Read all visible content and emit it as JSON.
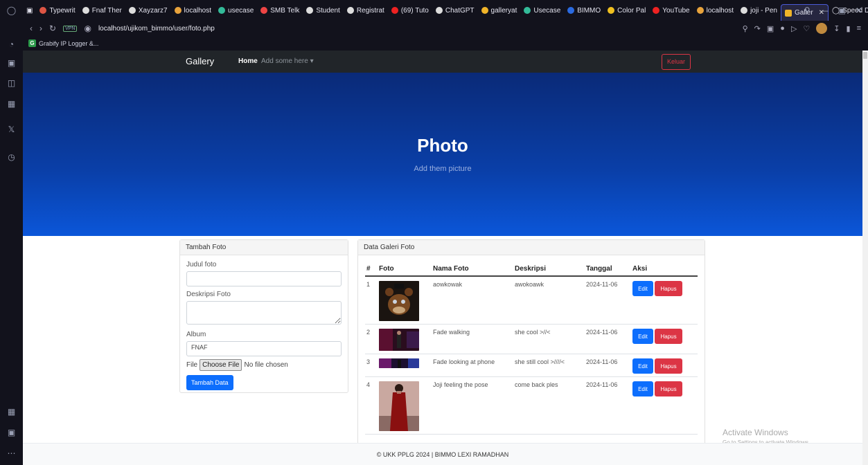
{
  "browser": {
    "tabs": [
      {
        "label": "Typewrit",
        "color": "#d54"
      },
      {
        "label": "Fnaf Ther",
        "color": "#ddd"
      },
      {
        "label": "Xayzarz7",
        "color": "#ddd"
      },
      {
        "label": "localhost",
        "color": "#e8a33c"
      },
      {
        "label": "usecase",
        "color": "#3b9"
      },
      {
        "label": "SMB Telk",
        "color": "#e44"
      },
      {
        "label": "Student",
        "color": "#ddd"
      },
      {
        "label": "Registrat",
        "color": "#ddd"
      },
      {
        "label": "(69) Tuto",
        "color": "#e22"
      },
      {
        "label": "ChatGPT",
        "color": "#ddd"
      },
      {
        "label": "galleryat",
        "color": "#f0b429"
      },
      {
        "label": "Usecase",
        "color": "#3b9"
      },
      {
        "label": "BIMMO",
        "color": "#2a6ae0"
      },
      {
        "label": "Color Pal",
        "color": "#f0c020"
      },
      {
        "label": "YouTube",
        "color": "#e22"
      },
      {
        "label": "localhost",
        "color": "#e8a33c"
      },
      {
        "label": "joji - Pen",
        "color": "#ddd"
      }
    ],
    "active_tab": "Galler",
    "extra_tab": "Speed Di",
    "url": "localhost/ujikom_bimmo/user/foto.php",
    "vpn": "VPN",
    "bookmark": "Grabify IP Logger &...",
    "bookmark_icon": "G"
  },
  "navbar": {
    "brand": "Gallery",
    "home": "Home",
    "dropdown": "Add some here ▾",
    "logout": "Keluar"
  },
  "hero": {
    "title": "Photo",
    "subtitle": "Add them picture"
  },
  "form": {
    "header": "Tambah Foto",
    "title_label": "Judul foto",
    "title_value": "",
    "desc_label": "Deskripsi Foto",
    "album_label": "Album",
    "album_value": "FNAF",
    "file_label": "File",
    "choose_file": "Choose File",
    "no_file": "No file chosen",
    "submit": "Tambah Data"
  },
  "gallery": {
    "header": "Data Galeri Foto",
    "columns": [
      "#",
      "Foto",
      "Nama Foto",
      "Deskripsi",
      "Tanggal",
      "Aksi"
    ],
    "rows": [
      {
        "no": "1",
        "name": "aowkowak",
        "desc": "awokoawk",
        "date": "2024-11-06"
      },
      {
        "no": "2",
        "name": "Fade walking",
        "desc": "she cool >//<",
        "date": "2024-11-06"
      },
      {
        "no": "3",
        "name": "Fade looking at phone",
        "desc": "she still cool >////<",
        "date": "2024-11-06"
      },
      {
        "no": "4",
        "name": "Joji feeling the pose",
        "desc": "come back ples",
        "date": "2024-11-06"
      }
    ],
    "edit_label": "Edit",
    "delete_label": "Hapus"
  },
  "footer": {
    "text": "© UKK PPLG 2024 | BIMMO LEXI RAMADHAN"
  },
  "watermark": {
    "line1": "Activate Windows",
    "line2": "Go to Settings to activate Windows."
  }
}
